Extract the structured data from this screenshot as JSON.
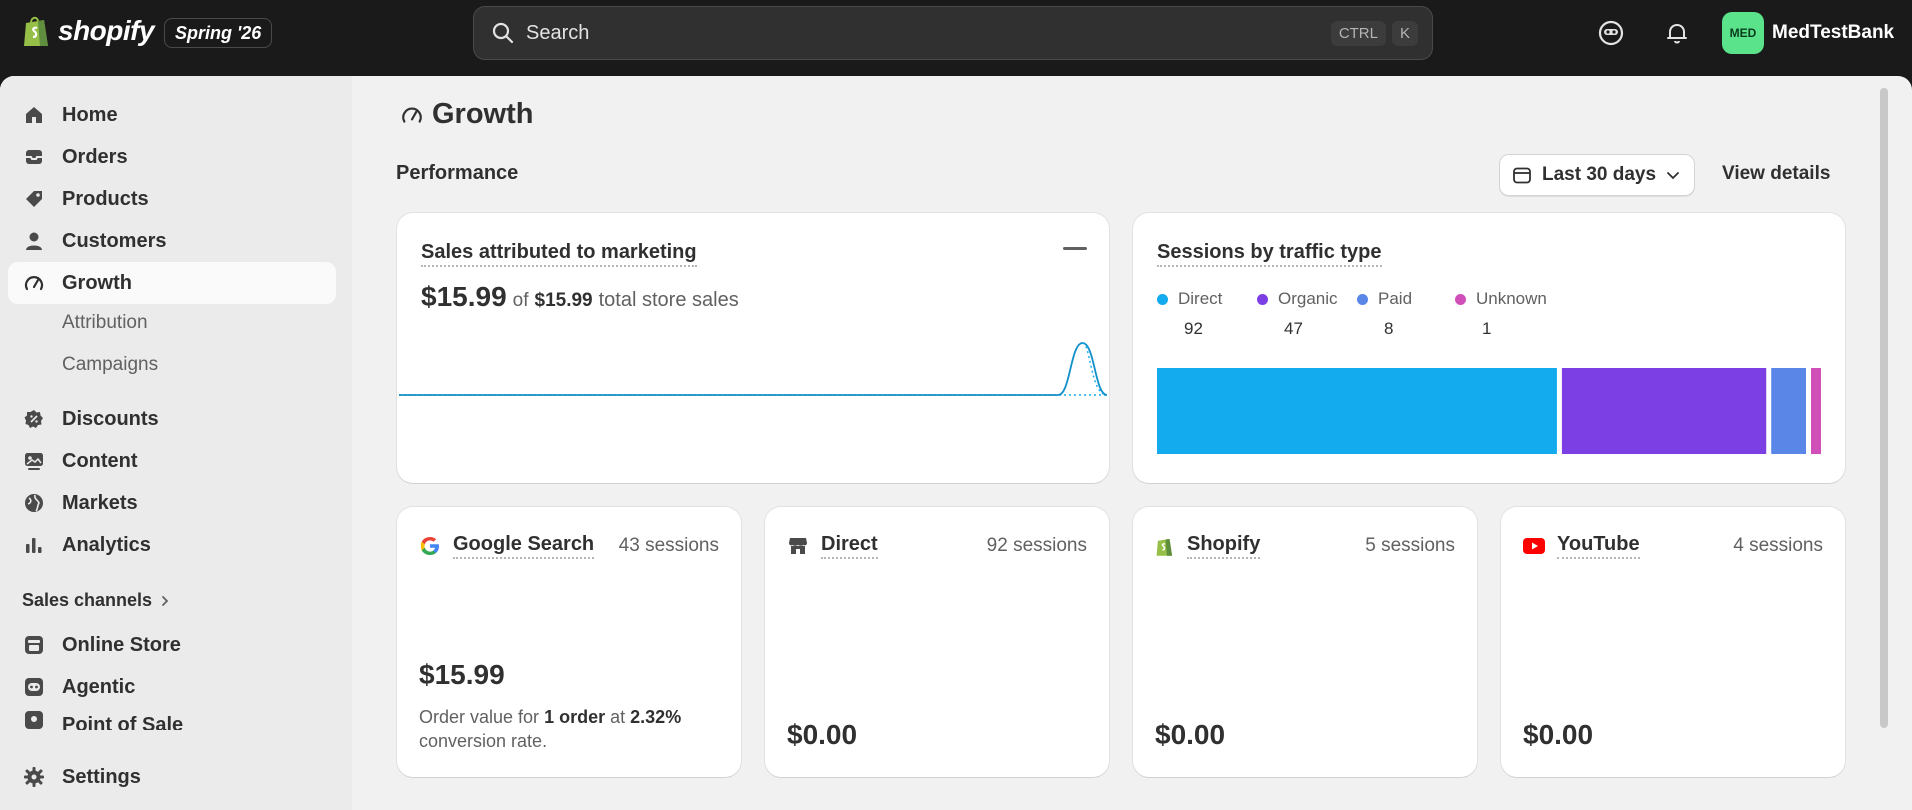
{
  "topbar": {
    "brand": "shopify",
    "edition": "Spring '26",
    "search_placeholder": "Search",
    "shortcut_modifier": "CTRL",
    "shortcut_key": "K",
    "user_initials": "MED",
    "user_name": "MedTestBank"
  },
  "sidebar": {
    "items": [
      {
        "label": "Home",
        "icon": "home-icon"
      },
      {
        "label": "Orders",
        "icon": "orders-icon"
      },
      {
        "label": "Products",
        "icon": "tag-icon"
      },
      {
        "label": "Customers",
        "icon": "person-icon"
      },
      {
        "label": "Growth",
        "icon": "gauge-icon",
        "active": true
      },
      {
        "label": "Discounts",
        "icon": "discount-icon"
      },
      {
        "label": "Content",
        "icon": "content-icon"
      },
      {
        "label": "Markets",
        "icon": "globe-icon"
      },
      {
        "label": "Analytics",
        "icon": "bar-chart-icon"
      }
    ],
    "growth_sub": [
      "Attribution",
      "Campaigns"
    ],
    "sales_channels_label": "Sales channels",
    "channels": [
      "Online Store",
      "Agentic",
      "Point of Sale"
    ],
    "settings_label": "Settings"
  },
  "page": {
    "title": "Growth",
    "section": "Performance",
    "date_range": "Last 30 days",
    "view_details": "View details"
  },
  "sales_card": {
    "title": "Sales attributed to marketing",
    "value": "$15.99",
    "of": "of",
    "total": "$15.99",
    "suffix": "total store sales"
  },
  "sessions_card": {
    "title": "Sessions by traffic type",
    "colors": {
      "Direct": "#13aaee",
      "Organic": "#7b3fe4",
      "Paid": "#5a86e8",
      "Unknown": "#d04fb8"
    }
  },
  "chart_data": [
    {
      "type": "line",
      "series": [
        {
          "values": [
            0,
            0,
            0,
            0,
            0,
            0,
            0,
            0,
            0,
            0,
            0,
            0,
            0,
            0,
            0,
            0,
            0,
            0,
            0,
            0,
            0,
            0,
            0,
            0,
            0,
            0,
            0,
            0,
            15.99,
            0
          ]
        }
      ]
    },
    {
      "type": "bar",
      "categories": [
        "Direct",
        "Organic",
        "Paid",
        "Unknown"
      ],
      "values": [
        92,
        47,
        8,
        1
      ]
    }
  ],
  "sources": [
    {
      "name": "Google Search",
      "icon": "google-icon",
      "sessions": "43 sessions",
      "value": "$15.99",
      "detail_prefix": "Order value for",
      "detail_orders": "1 order",
      "detail_mid": "at",
      "detail_rate": "2.32%",
      "detail_suffix": "conversion rate."
    },
    {
      "name": "Direct",
      "icon": "store-icon",
      "sessions": "92 sessions",
      "value": "$0.00"
    },
    {
      "name": "Shopify",
      "icon": "shopify-bag-icon",
      "sessions": "5 sessions",
      "value": "$0.00"
    },
    {
      "name": "YouTube",
      "icon": "youtube-icon",
      "sessions": "4 sessions",
      "value": "$0.00"
    }
  ]
}
